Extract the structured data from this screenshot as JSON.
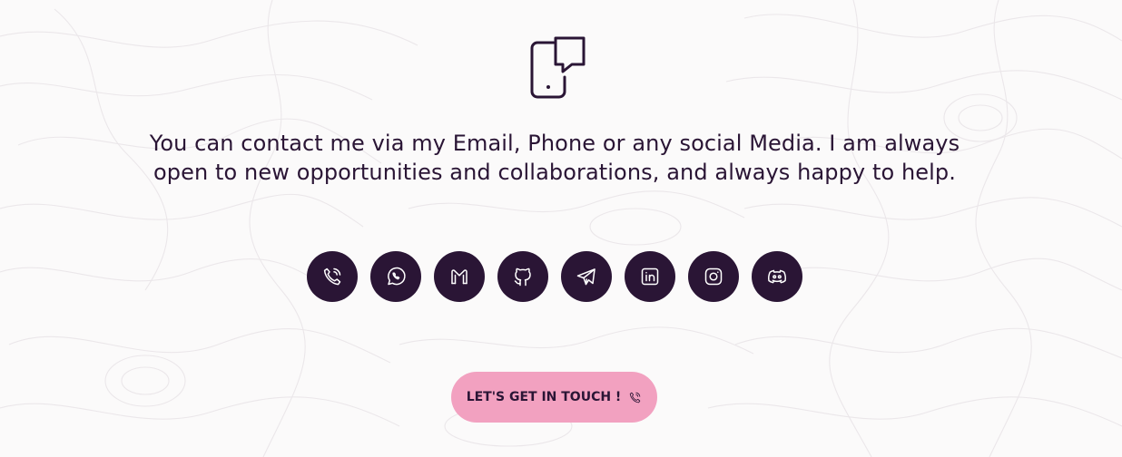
{
  "colors": {
    "background": "#fbfafa",
    "primary": "#2a1535",
    "button": "#f2a1c0"
  },
  "hero": {
    "icon": "mobile-chat-icon"
  },
  "intro": {
    "line1": "You can contact me via my Email, Phone or any social Media. I am always",
    "line2": "open to new opportunities and collaborations, and always happy to help."
  },
  "socials": [
    {
      "name": "Phone",
      "icon": "phone-icon"
    },
    {
      "name": "WhatsApp",
      "icon": "whatsapp-icon"
    },
    {
      "name": "Gmail",
      "icon": "gmail-icon"
    },
    {
      "name": "GitHub",
      "icon": "github-icon"
    },
    {
      "name": "Telegram",
      "icon": "telegram-icon"
    },
    {
      "name": "LinkedIn",
      "icon": "linkedin-icon"
    },
    {
      "name": "Instagram",
      "icon": "instagram-icon"
    },
    {
      "name": "Discord",
      "icon": "discord-icon"
    }
  ],
  "cta": {
    "label": "LET'S GET IN TOUCH !",
    "icon": "phone-icon"
  }
}
